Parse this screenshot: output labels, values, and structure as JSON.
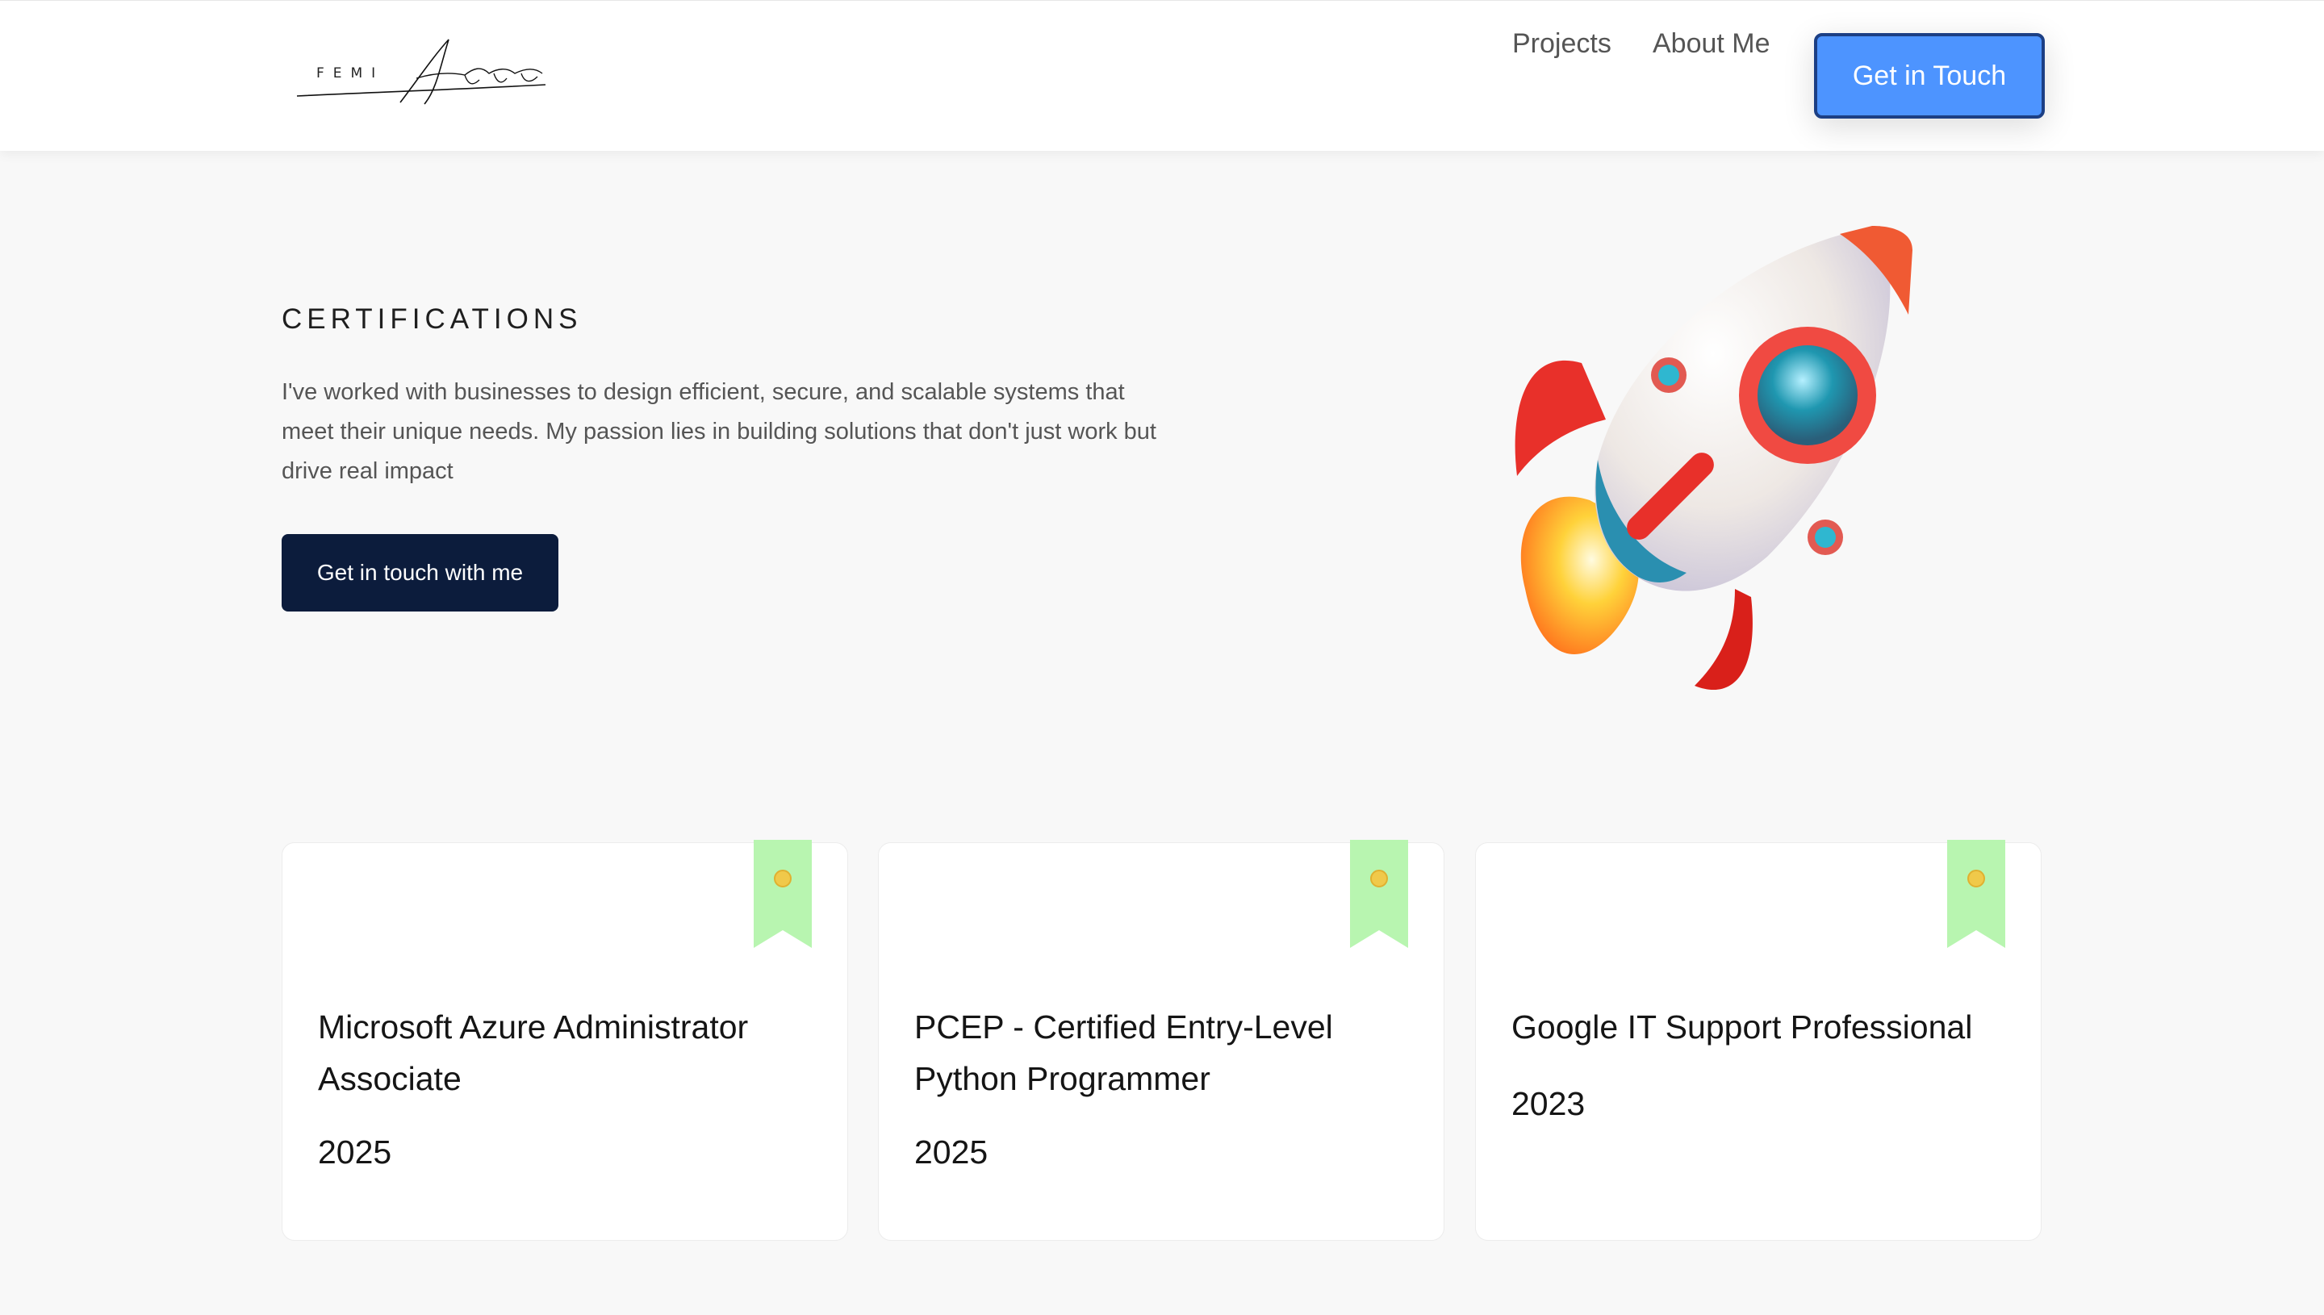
{
  "header": {
    "logo_small": "FEMI",
    "logo_script": "Akinlosotu",
    "nav": [
      {
        "label": "Projects"
      },
      {
        "label": "About Me"
      }
    ],
    "cta_label": "Get in Touch"
  },
  "hero": {
    "title": "CERTIFICATIONS",
    "description": "I've worked with businesses to design efficient, secure, and scalable systems that meet their unique needs. My passion lies in building solutions that don't just work but drive real impact",
    "cta_label": "Get in touch with me",
    "illustration": "rocket-illustration"
  },
  "certifications": [
    {
      "title": "Microsoft Azure Administrator Associate",
      "year": "2025"
    },
    {
      "title": "PCEP - Certified Entry-Level Python Programmer",
      "year": "2025"
    },
    {
      "title": "Google IT Support Professional",
      "year": "2023"
    }
  ],
  "colors": {
    "accent": "#4d94ff",
    "dark_button": "#0c1c3c",
    "ribbon": "#b8f5b0",
    "ribbon_medal": "#f0c94a"
  }
}
